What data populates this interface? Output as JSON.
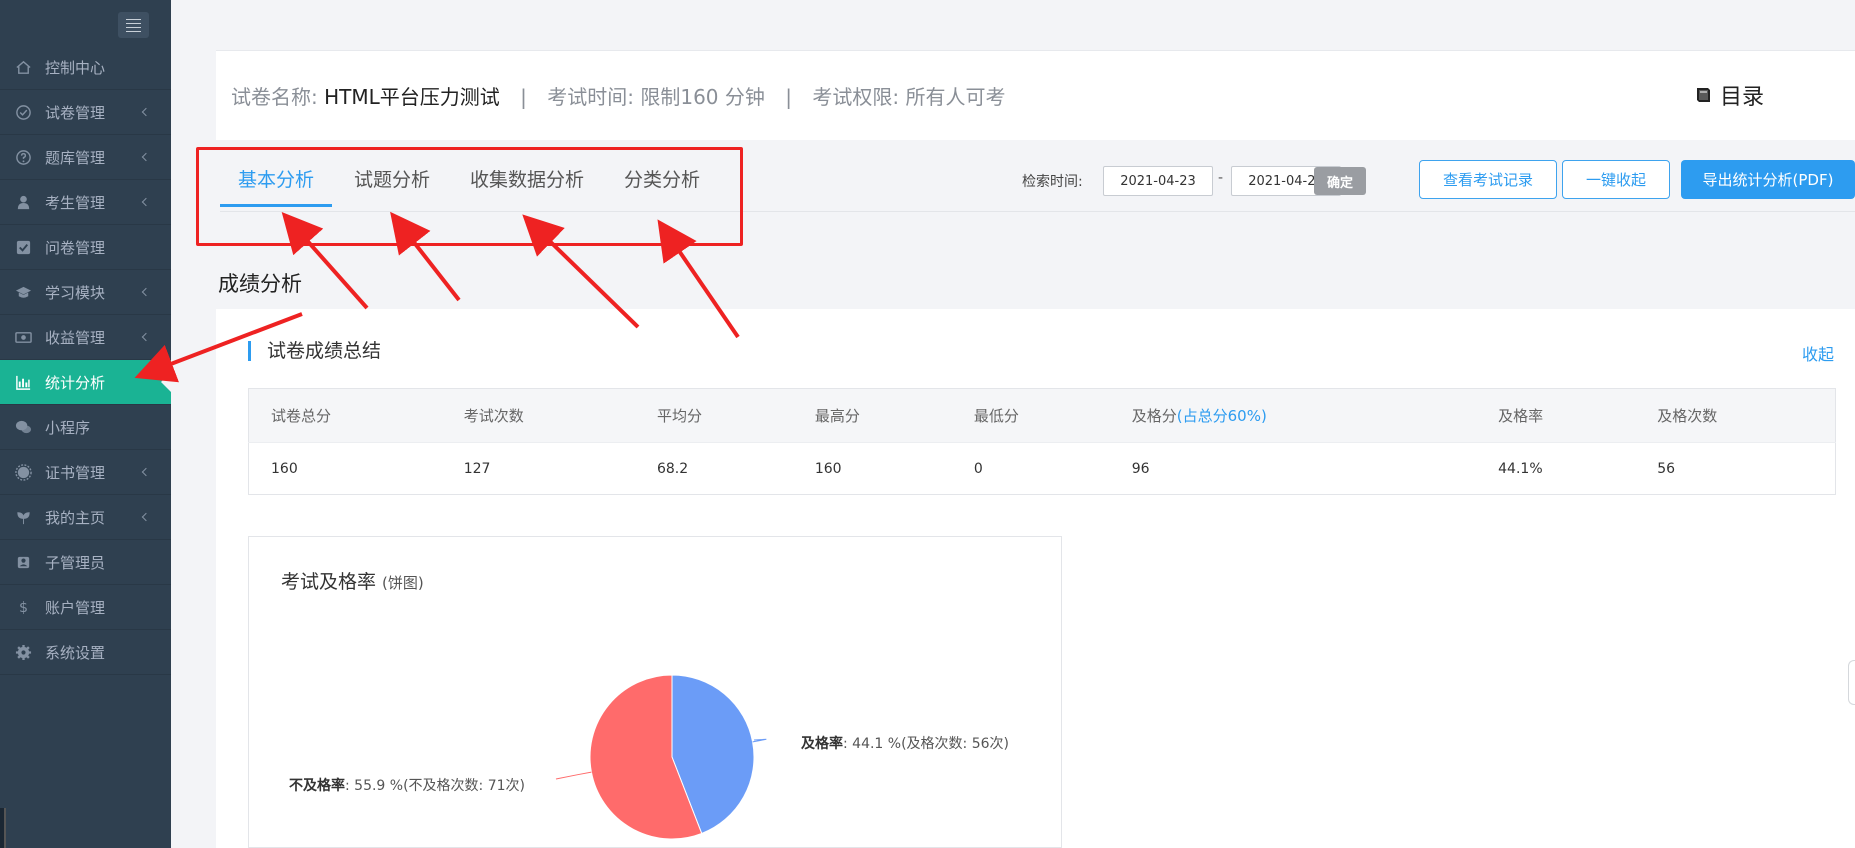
{
  "sidebar": {
    "items": [
      {
        "label": "控制中心",
        "icon": "home-icon",
        "chevron": false
      },
      {
        "label": "试卷管理",
        "icon": "check-circle-icon",
        "chevron": true
      },
      {
        "label": "题库管理",
        "icon": "question-circle-icon",
        "chevron": true
      },
      {
        "label": "考生管理",
        "icon": "user-icon",
        "chevron": true
      },
      {
        "label": "问卷管理",
        "icon": "check-square-icon",
        "chevron": false
      },
      {
        "label": "学习模块",
        "icon": "graduation-cap-icon",
        "chevron": true
      },
      {
        "label": "收益管理",
        "icon": "money-icon",
        "chevron": true
      },
      {
        "label": "统计分析",
        "icon": "bar-chart-icon",
        "chevron": false,
        "active": true
      },
      {
        "label": "小程序",
        "icon": "wechat-icon",
        "chevron": false
      },
      {
        "label": "证书管理",
        "icon": "certificate-icon",
        "chevron": true
      },
      {
        "label": "我的主页",
        "icon": "leaf-icon",
        "chevron": true
      },
      {
        "label": "子管理员",
        "icon": "users-icon",
        "chevron": false
      },
      {
        "label": "账户管理",
        "icon": "dollar-icon",
        "chevron": false
      },
      {
        "label": "系统设置",
        "icon": "gear-icon",
        "chevron": false
      }
    ]
  },
  "header": {
    "name_label": "试卷名称:",
    "name_value": "HTML平台压力测试",
    "time_label": "考试时间:",
    "time_value": "限制160 分钟",
    "perm_label": "考试权限:",
    "perm_value": "所有人可考",
    "separator": "|",
    "catalog": "目录"
  },
  "tabs": [
    {
      "label": "基本分析",
      "active": true
    },
    {
      "label": "试题分析"
    },
    {
      "label": "收集数据分析"
    },
    {
      "label": "分类分析"
    }
  ],
  "search": {
    "label": "检索时间:",
    "start_date": "2021-04-23",
    "dash": "-",
    "end_date": "2021-04-27",
    "confirm": "确定"
  },
  "actions": {
    "view_records": "查看考试记录",
    "collapse_all": "一键收起",
    "export_pdf": "导出统计分析(PDF)"
  },
  "section_title": "成绩分析",
  "summary": {
    "title": "试卷成绩总结",
    "collapse": "收起",
    "headers": [
      "试卷总分",
      "考试次数",
      "平均分",
      "最高分",
      "最低分",
      "及格分",
      "及格率",
      "及格次数"
    ],
    "pass_note": "(占总分60%)",
    "values": [
      "160",
      "127",
      "68.2",
      "160",
      "0",
      "96",
      "44.1%",
      "56"
    ]
  },
  "pie": {
    "title": "考试及格率",
    "subtitle": "(饼图)",
    "colors": {
      "pass": "#6b9cf7",
      "fail": "#ff6b6b",
      "accent": "#2d9cf0",
      "active": "#1ab394",
      "annotation": "#ee2222"
    },
    "pass_name": "及格率",
    "pass_text": ": 44.1 %(及格次数: 56次)",
    "fail_name": "不及格率",
    "fail_text": ": 55.9 %(不及格次数: 71次)"
  },
  "chart_data": {
    "type": "pie",
    "title": "考试及格率",
    "subtitle": "(饼图)",
    "slices": [
      {
        "name": "及格率",
        "value": 44.1,
        "count": 56
      },
      {
        "name": "不及格率",
        "value": 55.9,
        "count": 71
      }
    ]
  }
}
